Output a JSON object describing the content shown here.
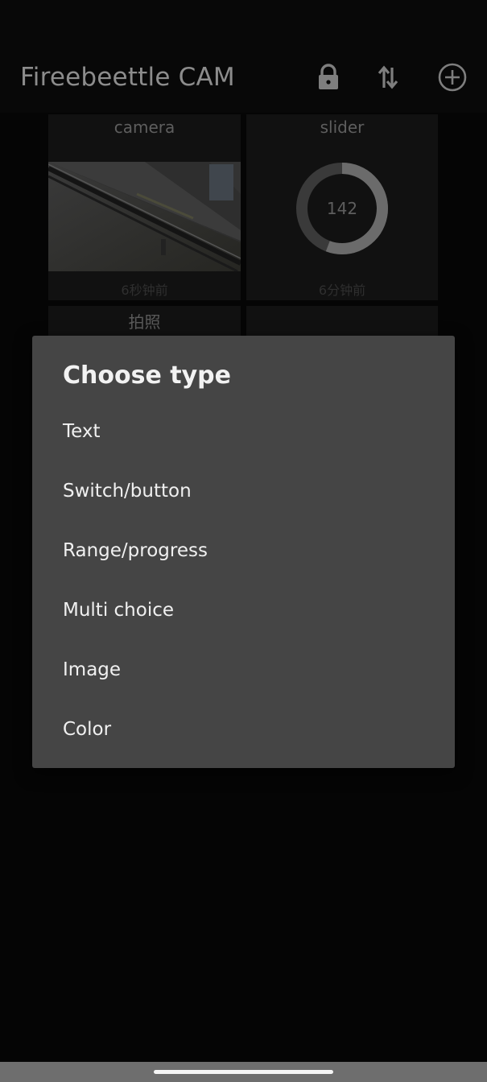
{
  "app": {
    "title": "Fireebeettle CAM"
  },
  "toolbar": {
    "icons": [
      "lock-icon",
      "sort-icon",
      "add-circle-icon"
    ]
  },
  "widgets": [
    {
      "title": "camera",
      "type": "image",
      "time": "6秒钟前"
    },
    {
      "title": "slider",
      "type": "range",
      "value": "142",
      "time": "6分钟前"
    },
    {
      "title": "拍照",
      "type": "button"
    },
    {
      "title": "",
      "type": "empty"
    }
  ],
  "dialog": {
    "title": "Choose type",
    "options": [
      "Text",
      "Switch/button",
      "Range/progress",
      "Multi choice",
      "Image",
      "Color"
    ]
  },
  "colors": {
    "dialog_bg": "#454545",
    "screen_bg": "#050505",
    "gauge_fill": "#6b6b6b"
  },
  "slider_gauge": {
    "value": 142,
    "max": 255
  }
}
